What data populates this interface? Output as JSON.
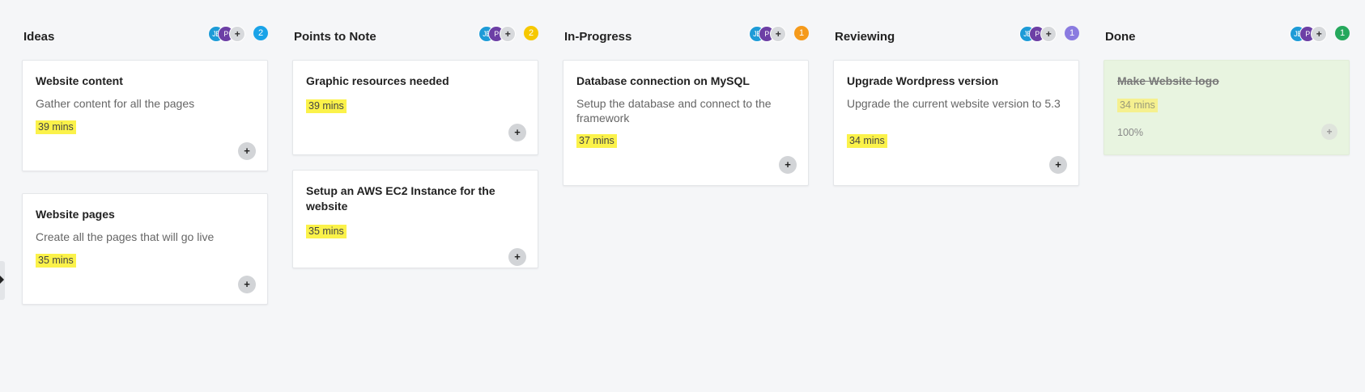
{
  "sidebar": {
    "toggle_icon": "arrow-right-icon"
  },
  "columns": [
    {
      "title": "Ideas",
      "count": "2",
      "count_color": "#1aa3e8",
      "avatars": [
        "JE",
        "P",
        "+"
      ],
      "cards": [
        {
          "title": "Website content",
          "description": "Gather content for all the pages",
          "time": "39 mins",
          "add": "+"
        },
        {
          "title": "Website pages",
          "description": "Create all the pages that will go live",
          "time": "35 mins",
          "add": "+"
        }
      ]
    },
    {
      "title": "Points to Note",
      "count": "2",
      "count_color": "#f6c800",
      "avatars": [
        "JE",
        "P",
        "+"
      ],
      "cards": [
        {
          "title": "Graphic resources needed",
          "time": "39 mins",
          "add": "+"
        },
        {
          "title": "Setup an AWS EC2 Instance for the website",
          "time": "35 mins",
          "add": "+"
        }
      ]
    },
    {
      "title": "In-Progress",
      "count": "1",
      "count_color": "#f59a1b",
      "avatars": [
        "JE",
        "P",
        "+"
      ],
      "cards": [
        {
          "title": "Database connection on MySQL",
          "description": "Setup the database and connect to the framework",
          "time": "37 mins",
          "add": "+"
        }
      ]
    },
    {
      "title": "Reviewing",
      "count": "1",
      "count_color": "#8a7be0",
      "avatars": [
        "JE",
        "P",
        "+"
      ],
      "cards": [
        {
          "title": "Upgrade Wordpress version",
          "description": "Upgrade the current website version to 5.3",
          "time": "34 mins",
          "add": "+"
        }
      ]
    },
    {
      "title": "Done",
      "count": "1",
      "count_color": "#25a85c",
      "avatars": [
        "JE",
        "P",
        "+"
      ],
      "cards": [
        {
          "title": "Make Website logo",
          "time": "34 mins",
          "progress": "100%",
          "add": "+"
        }
      ]
    }
  ]
}
